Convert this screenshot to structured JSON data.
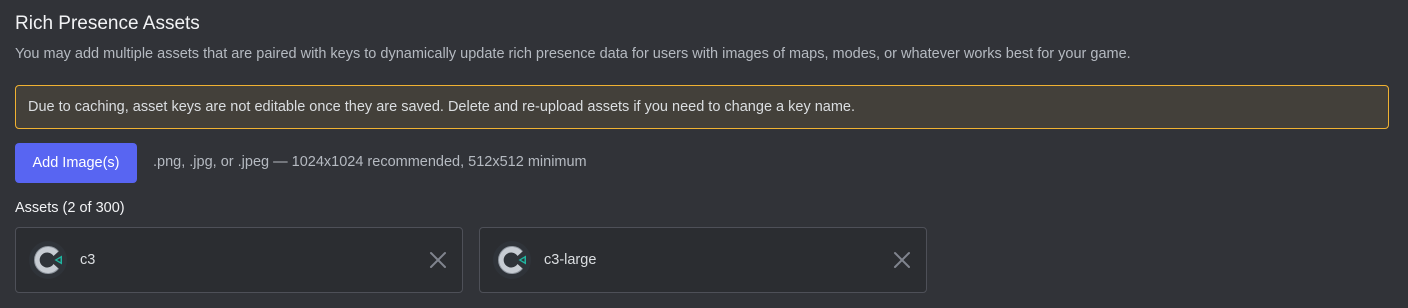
{
  "section": {
    "title": "Rich Presence Assets",
    "description": "You may add multiple assets that are paired with keys to dynamically update rich presence data for users with images of maps, modes, or whatever works best for your game.",
    "warning": "Due to caching, asset keys are not editable once they are saved. Delete and re-upload assets if you need to change a key name.",
    "add_button_label": "Add Image(s)",
    "format_hint": ".png, .jpg, or .jpeg — 1024x1024 recommended, 512x512 minimum",
    "assets_heading": "Assets (2 of 300)"
  },
  "assets": [
    {
      "key": "c3",
      "icon": "c3-logo-icon"
    },
    {
      "key": "c3-large",
      "icon": "c3-logo-icon"
    }
  ],
  "colors": {
    "background": "#313338",
    "card_background": "#2b2d31",
    "card_border": "#4e5058",
    "warning_border": "#f0b232",
    "warning_background": "#43403a",
    "brand": "#5865f2",
    "logo_accent": "#1fb5a0"
  },
  "icons": {
    "remove": "close-icon"
  }
}
